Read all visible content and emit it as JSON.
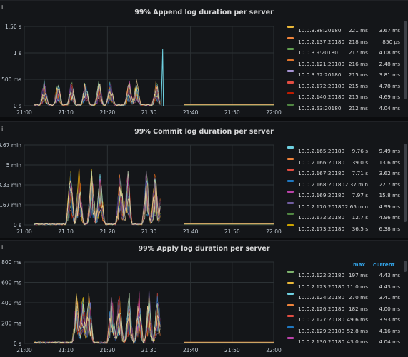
{
  "panels": [
    {
      "title": "99% Append log duration per server",
      "info_icon": "info-icon",
      "y_ticks": [
        "1.50 s",
        "1 s",
        "500 ms",
        "0 s"
      ],
      "x_ticks": [
        "21:00",
        "21:10",
        "21:20",
        "21:30",
        "21:40",
        "21:50",
        "22:00"
      ],
      "legend": [
        {
          "name": "10.0.3.88:20180",
          "max": "221 ms",
          "current": "3.67 ms",
          "color": "#eab839"
        },
        {
          "name": "10.0.2.137:20180",
          "max": "218 ms",
          "current": "850 µs",
          "color": "#ef843c"
        },
        {
          "name": "10.0.3.9:20180",
          "max": "217 ms",
          "current": "4.08 ms",
          "color": "#629e51"
        },
        {
          "name": "10.0.3.121:20180",
          "max": "216 ms",
          "current": "2.48 ms",
          "color": "#e0752d"
        },
        {
          "name": "10.0.3.52:20180",
          "max": "215 ms",
          "current": "3.81 ms",
          "color": "#a794d4"
        },
        {
          "name": "10.0.2.172:20180",
          "max": "215 ms",
          "current": "4.78 ms",
          "color": "#e24d42"
        },
        {
          "name": "10.0.2.140:20180",
          "max": "215 ms",
          "current": "4.69 ms",
          "color": "#bf1b00"
        },
        {
          "name": "10.0.3.53:20180",
          "max": "212 ms",
          "current": "4.04 ms",
          "color": "#508642"
        }
      ]
    },
    {
      "title": "99% Commit log duration per server",
      "info_icon": "info-icon",
      "y_ticks": [
        "6.67 min",
        "5 min",
        "3.33 min",
        "1.67 min",
        "0 s"
      ],
      "x_ticks": [
        "21:00",
        "21:10",
        "21:20",
        "21:30",
        "21:40",
        "21:50",
        "22:00"
      ],
      "legend": [
        {
          "name": "10.0.2.165:20180",
          "max": "9.76 s",
          "current": "9.49 ms",
          "color": "#6ed0e0"
        },
        {
          "name": "10.0.2.166:20180",
          "max": "39.0 s",
          "current": "13.6 ms",
          "color": "#ef843c"
        },
        {
          "name": "10.0.2.167:20180",
          "max": "7.71 s",
          "current": "3.62 ms",
          "color": "#e24d42"
        },
        {
          "name": "10.0.2.168:20180",
          "max": "2.37 min",
          "current": "22.7 ms",
          "color": "#1f78c1"
        },
        {
          "name": "10.0.2.169:20180",
          "max": "7.97 s",
          "current": "15.8 ms",
          "color": "#ba43a9"
        },
        {
          "name": "10.0.2.170:20180",
          "max": "2.65 min",
          "current": "4.99 ms",
          "color": "#705da0"
        },
        {
          "name": "10.0.2.172:20180",
          "max": "12.7 s",
          "current": "4.96 ms",
          "color": "#508642"
        },
        {
          "name": "10.0.2.173:20180",
          "max": "36.5 s",
          "current": "6.38 ms",
          "color": "#cca300"
        }
      ]
    },
    {
      "title": "99% Apply log duration per server",
      "info_icon": "info-icon",
      "y_ticks": [
        "800 ms",
        "600 ms",
        "400 ms",
        "200 ms",
        "0 s"
      ],
      "x_ticks": [
        "21:00",
        "21:10",
        "21:20",
        "21:30",
        "21:40",
        "21:50",
        "22:00"
      ],
      "legend_headers": {
        "max": "max",
        "current": "current"
      },
      "legend": [
        {
          "name": "10.0.2.122:20180",
          "max": "197 ms",
          "current": "4.43 ms",
          "color": "#7eb26d"
        },
        {
          "name": "10.0.2.123:20180",
          "max": "11.0 ms",
          "current": "4.43 ms",
          "color": "#eab839"
        },
        {
          "name": "10.0.2.124:20180",
          "max": "270 ms",
          "current": "3.41 ms",
          "color": "#6ed0e0"
        },
        {
          "name": "10.0.2.126:20180",
          "max": "182 ms",
          "current": "4.00 ms",
          "color": "#ef843c"
        },
        {
          "name": "10.0.2.127:20180",
          "max": "49.6 ms",
          "current": "3.93 ms",
          "color": "#e24d42"
        },
        {
          "name": "10.0.2.129:20180",
          "max": "52.8 ms",
          "current": "4.16 ms",
          "color": "#1f78c1"
        },
        {
          "name": "10.0.2.130:20180",
          "max": "43.0 ms",
          "current": "4.04 ms",
          "color": "#ba43a9"
        }
      ]
    }
  ]
}
